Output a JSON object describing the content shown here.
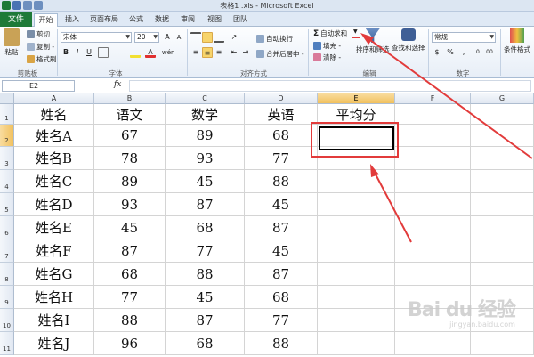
{
  "window_title": "表格1 .xls - Microsoft Excel",
  "tabs": {
    "file": "文件",
    "home": "开始",
    "insert": "插入",
    "layout": "页面布局",
    "formulas": "公式",
    "data": "数据",
    "review": "审阅",
    "view": "视图",
    "team": "团队"
  },
  "ribbon": {
    "clipboard": {
      "paste": "粘贴",
      "cut": "剪切",
      "copy": "复制 -",
      "format_painter": "格式刷",
      "label": "剪贴板"
    },
    "font": {
      "name": "宋体",
      "size": "20",
      "label": "字体"
    },
    "alignment": {
      "wrap": "自动换行",
      "merge": "合并后居中 -",
      "label": "对齐方式"
    },
    "editing": {
      "autosum": "自动求和",
      "fill": "填充 -",
      "clear": "清除 -",
      "sort": "排序和筛选",
      "find": "查找和选择",
      "label": "编辑"
    },
    "number": {
      "format": "常规",
      "label": "数字"
    },
    "styles": {
      "conditional": "条件格式"
    }
  },
  "formula_bar": {
    "cell_ref": "E2",
    "fx": "fx",
    "value": ""
  },
  "columns": [
    "A",
    "B",
    "C",
    "D",
    "E",
    "F",
    "G"
  ],
  "rows": [
    "1",
    "2",
    "3",
    "4",
    "5",
    "6",
    "7",
    "8",
    "9",
    "10",
    "11"
  ],
  "header_row": {
    "a": "姓名",
    "b": "语文",
    "c": "数学",
    "d": "英语",
    "e": "平均分"
  },
  "table": [
    {
      "name": "姓名A",
      "yuwen": "67",
      "shuxue": "89",
      "yingyu": "68"
    },
    {
      "name": "姓名B",
      "yuwen": "78",
      "shuxue": "93",
      "yingyu": "77"
    },
    {
      "name": "姓名C",
      "yuwen": "89",
      "shuxue": "45",
      "yingyu": "88"
    },
    {
      "name": "姓名D",
      "yuwen": "93",
      "shuxue": "87",
      "yingyu": "45"
    },
    {
      "name": "姓名E",
      "yuwen": "45",
      "shuxue": "68",
      "yingyu": "87"
    },
    {
      "name": "姓名F",
      "yuwen": "87",
      "shuxue": "77",
      "yingyu": "45"
    },
    {
      "name": "姓名G",
      "yuwen": "68",
      "shuxue": "88",
      "yingyu": "87"
    },
    {
      "name": "姓名H",
      "yuwen": "77",
      "shuxue": "45",
      "yingyu": "68"
    },
    {
      "name": "姓名I",
      "yuwen": "88",
      "shuxue": "87",
      "yingyu": "77"
    },
    {
      "name": "姓名J",
      "yuwen": "96",
      "shuxue": "68",
      "yingyu": "88"
    }
  ],
  "watermark": {
    "logo": "Bai du 经验",
    "site": "jingyan.baidu.com"
  },
  "colors": {
    "file_tab": "#1e7a38",
    "selection_header": "#f1c15f",
    "annotation_red": "#e23b3b"
  }
}
